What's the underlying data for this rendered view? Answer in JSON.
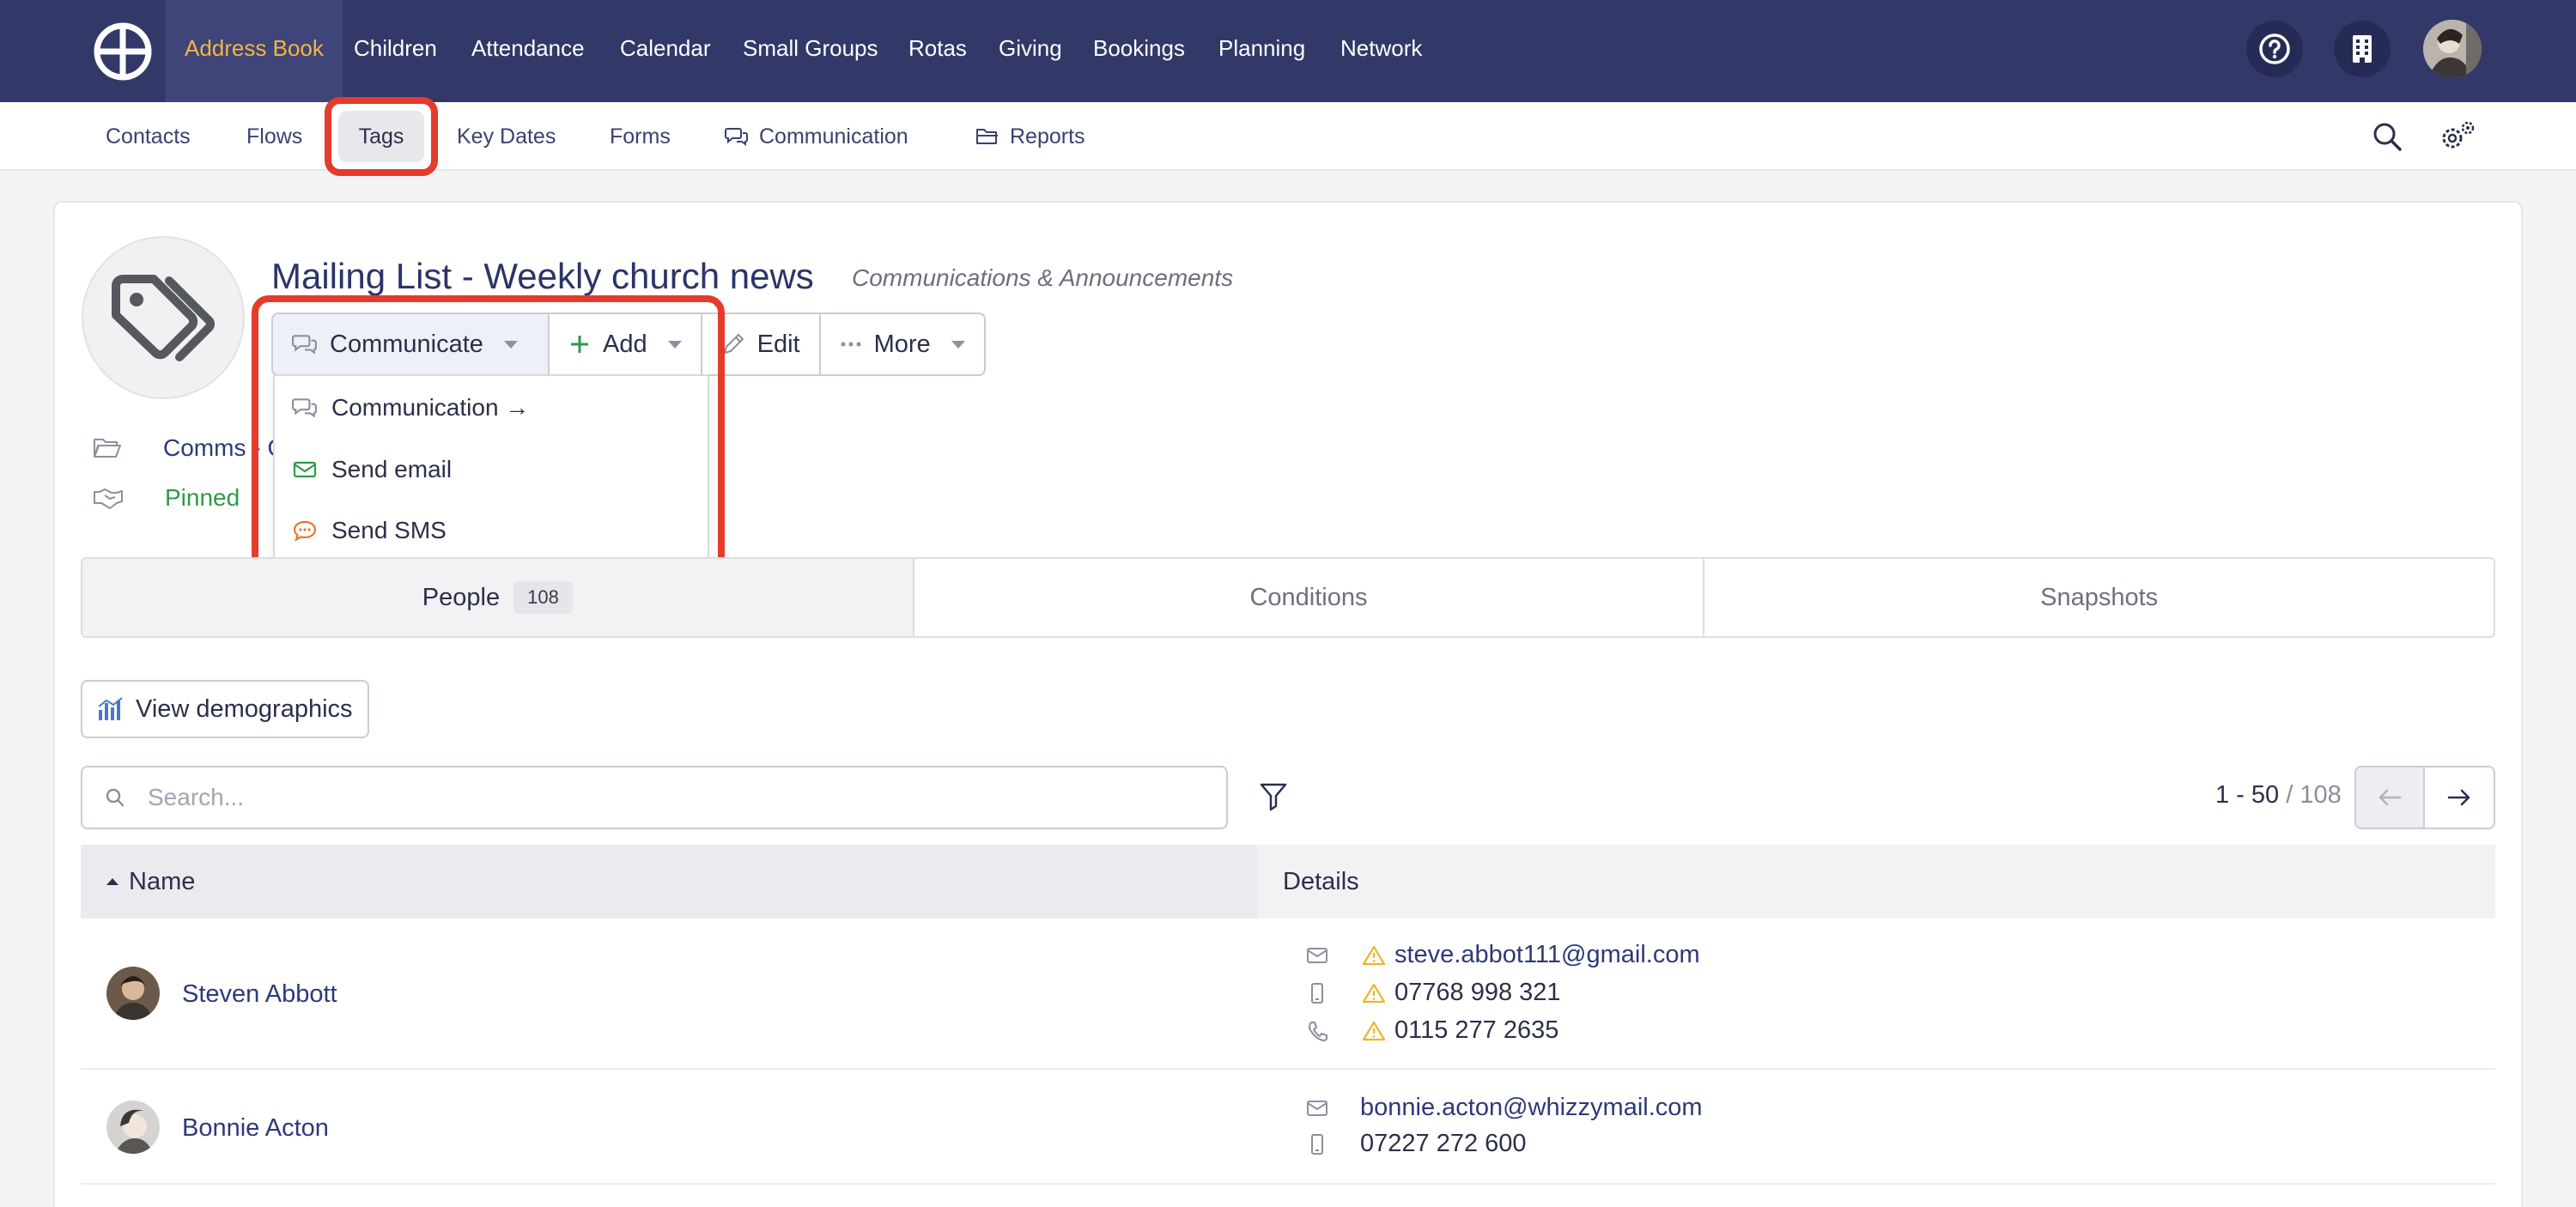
{
  "topnav": {
    "items": [
      {
        "label": "Address Book",
        "active": true
      },
      {
        "label": "Children"
      },
      {
        "label": "Attendance"
      },
      {
        "label": "Calendar"
      },
      {
        "label": "Small Groups"
      },
      {
        "label": "Rotas"
      },
      {
        "label": "Giving"
      },
      {
        "label": "Bookings"
      },
      {
        "label": "Planning"
      },
      {
        "label": "Network"
      }
    ],
    "icons": [
      "help-icon",
      "building-icon",
      "user-avatar"
    ],
    "colors": {
      "bar": "#323868",
      "active_text": "#f3b544"
    }
  },
  "subnav": {
    "items": [
      {
        "label": "Contacts"
      },
      {
        "label": "Flows"
      },
      {
        "label": "Tags",
        "active": true
      },
      {
        "label": "Key Dates"
      },
      {
        "label": "Forms"
      },
      {
        "label": "Communication",
        "icon": "chat-icon"
      },
      {
        "label": "Reports",
        "icon": "folder-icon"
      }
    ]
  },
  "tag": {
    "title": "Mailing List - Weekly church news",
    "category": "Communications & Announcements",
    "folder": "Comms - C",
    "status": "Pinned"
  },
  "actions": {
    "communicate": "Communicate",
    "add": "Add",
    "edit": "Edit",
    "more": "More"
  },
  "communicate_menu": [
    {
      "label": "Communication →",
      "icon": "chat-icon"
    },
    {
      "label": "Send email",
      "icon": "envelope-icon"
    },
    {
      "label": "Send SMS",
      "icon": "sms-icon"
    }
  ],
  "tabs": [
    {
      "label": "People",
      "count": "108",
      "active": true
    },
    {
      "label": "Conditions"
    },
    {
      "label": "Snapshots"
    }
  ],
  "view_demographics": "View demographics",
  "search": {
    "placeholder": "Search..."
  },
  "pagination": {
    "range": "1 - 50",
    "total": "/ 108"
  },
  "table": {
    "columns": [
      "Name",
      "Details"
    ],
    "rows": [
      {
        "name": "Steven Abbott",
        "details": [
          {
            "icon": "envelope-icon",
            "warning": true,
            "value": "steve.abbot111@gmail.com"
          },
          {
            "icon": "mobile-icon",
            "warning": true,
            "value": "07768 998 321"
          },
          {
            "icon": "phone-icon",
            "warning": true,
            "value": "0115 277 2635"
          }
        ]
      },
      {
        "name": "Bonnie Acton",
        "details": [
          {
            "icon": "envelope-icon",
            "warning": false,
            "value": "bonnie.acton@whizzymail.com"
          },
          {
            "icon": "mobile-icon",
            "warning": false,
            "value": "07227 272 600"
          }
        ]
      }
    ]
  },
  "colors": {
    "highlight": "#e53b2c",
    "link": "#2d3a78",
    "pinned": "#2e9a47",
    "warning": "#f0b429"
  }
}
